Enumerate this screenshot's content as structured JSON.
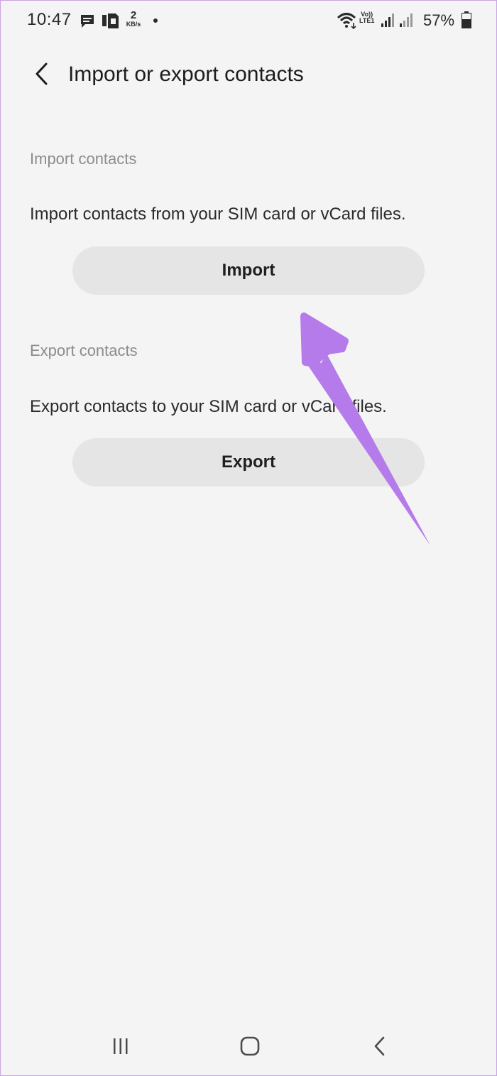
{
  "status_bar": {
    "time": "10:47",
    "net_speed_value": "2",
    "net_speed_unit": "KB/s",
    "volte_top": "Vo))",
    "volte_bottom": "LTE1",
    "battery_percent": "57%",
    "icons": [
      "message-icon",
      "sim-icon",
      "wifi-icon",
      "signal-icon",
      "signal-icon",
      "battery-icon"
    ]
  },
  "header": {
    "title": "Import or export contacts"
  },
  "import_section": {
    "label": "Import contacts",
    "description": "Import contacts from your SIM card or vCard files.",
    "button_label": "Import"
  },
  "export_section": {
    "label": "Export contacts",
    "description": "Export contacts to your SIM card or vCard files.",
    "button_label": "Export"
  },
  "nav_bar": {
    "icons": [
      "recent-apps-icon",
      "home-icon",
      "back-icon"
    ]
  },
  "colors": {
    "background": "#f4f4f4",
    "button_bg": "#e5e5e5",
    "section_label": "#8c8c8c",
    "annotation_arrow": "#b57bea"
  }
}
